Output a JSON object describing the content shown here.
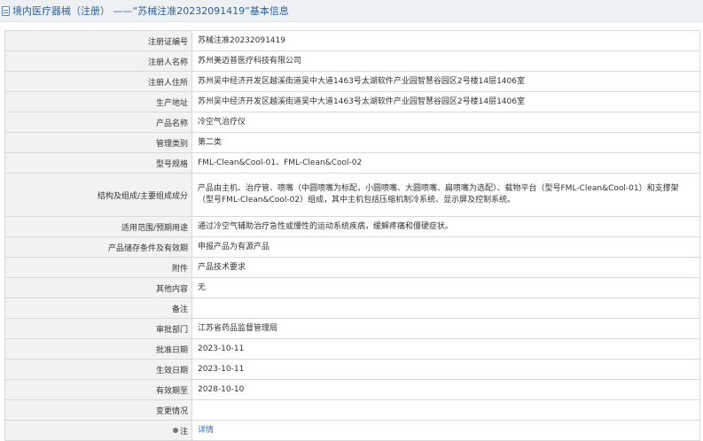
{
  "header": {
    "title": "境内医疗器械（注册） ——“苏械注准20232091419”基本信息"
  },
  "rows": [
    {
      "label": "注册证编号",
      "value": "苏械注准20232091419"
    },
    {
      "label": "注册人名称",
      "value": "苏州美迈普医疗科技有限公司"
    },
    {
      "label": "注册人住所",
      "value": "苏州吴中经济开发区越溪街道吴中大道1463号太湖软件产业园智慧谷园区2号楼14层1406室"
    },
    {
      "label": "生产地址",
      "value": "苏州吴中经济开发区越溪街道吴中大道1463号太湖软件产业园智慧谷园区2号楼14层1406室"
    },
    {
      "label": "产品名称",
      "value": "冷空气治疗仪"
    },
    {
      "label": "管理类别",
      "value": "第二类"
    },
    {
      "label": "型号规格",
      "value": "FML-Clean&Cool-01、FML-Clean&Cool-02"
    },
    {
      "label": "结构及组成/主要组成成分",
      "value": "产品由主机、治疗管、喷嘴（中圆喷嘴为标配，小圆喷嘴、大圆喷嘴、扁喷嘴为选配）、载物平台（型号FML-Clean&Cool-01）和支撑架（型号FML-Clean&Cool-02）组成，其中主机包括压缩机制冷系统、显示屏及控制系统。"
    },
    {
      "label": "适用范围/预期用途",
      "value": "通过冷空气辅助治疗急性或慢性的运动系统疾病，缓解疼痛和僵硬症状。"
    },
    {
      "label": "产品储存条件及有效期",
      "value": "申报产品为有源产品"
    },
    {
      "label": "附件",
      "value": "产品技术要求"
    },
    {
      "label": "其他内容",
      "value": "无"
    },
    {
      "label": "备注",
      "value": ""
    },
    {
      "label": "审批部门",
      "value": "江苏省药品监督管理局"
    },
    {
      "label": "批准日期",
      "value": "2023-10-11"
    },
    {
      "label": "生效日期",
      "value": "2023-10-11"
    },
    {
      "label": "有效期至",
      "value": "2028-10-10"
    },
    {
      "label": "变更情况",
      "value": ""
    },
    {
      "label": "注",
      "value": "详情"
    }
  ],
  "colors": {
    "header_bg": "#eef1f4",
    "header_text": "#2b5f99",
    "label_bg": "#f2f2f2",
    "border": "#d9d9d9",
    "link": "#2b6cb8"
  }
}
